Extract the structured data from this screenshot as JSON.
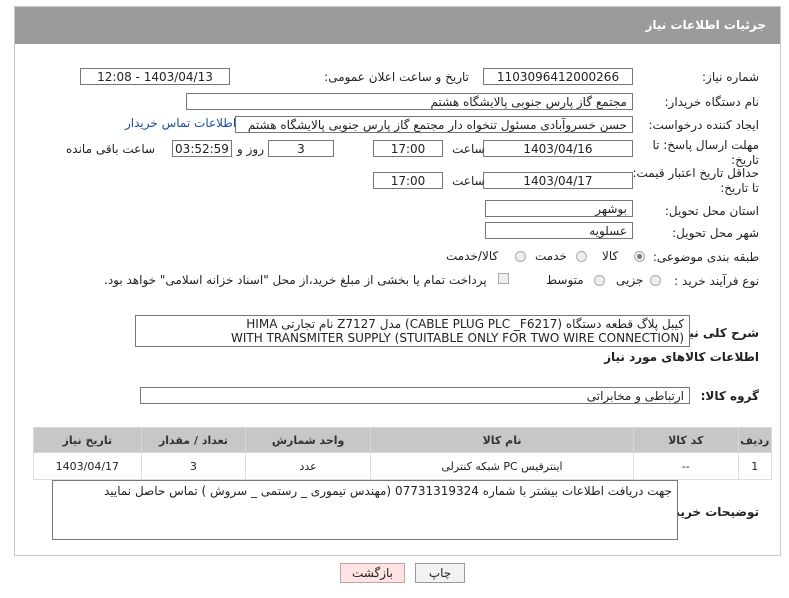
{
  "header": {
    "title": "جزئیات اطلاعات نیاز"
  },
  "form": {
    "need_number_label": "شماره نیاز:",
    "need_number": "1103096412000266",
    "announce_label": "تاریخ و ساعت اعلان عمومی:",
    "announce_value": "1403/04/13 - 12:08",
    "buyer_label": "نام دستگاه خریدار:",
    "buyer_value": "مجتمع گاز پارس جنوبی  پالایشگاه هشتم",
    "creator_label": "ایجاد کننده درخواست:",
    "creator_value": "حسن خسروآبادی مسئول تنخواه دار مجتمع گاز پارس جنوبی  پالایشگاه هشتم",
    "contact_link": "اطلاعات تماس خریدار",
    "deadline_label": "مهلت ارسال پاسخ: تا تاریخ:",
    "deadline_date": "1403/04/16",
    "time_label": "ساعت",
    "deadline_time": "17:00",
    "days_value": "3",
    "days_label": "روز و",
    "remaining_time": "03:52:59",
    "remaining_label": "ساعت باقی مانده",
    "price_valid_label": "حداقل تاریخ اعتبار قیمت: تا تاریخ:",
    "price_valid_date": "1403/04/17",
    "price_valid_time": "17:00",
    "province_label": "استان محل تحویل:",
    "province_value": "بوشهر",
    "city_label": "شهر محل تحویل:",
    "city_value": "عسلویه",
    "category_label": "طبقه بندی موضوعی:",
    "category_options": [
      "کالا",
      "خدمت",
      "کالا/خدمت"
    ],
    "process_label": "نوع فرآیند خرید :",
    "process_options": [
      "جزیی",
      "متوسط"
    ],
    "process_note": "پرداخت تمام یا بخشی از مبلغ خرید،از محل \"اسناد خزانه اسلامی\" خواهد بود.",
    "summary_label": "شرح کلی نیاز:",
    "summary_line1": "کیبل پلاگ قطعه دستگاه (CABLE PLUG  PLC _F6217)  مدل Z7127 نام تجارتی HIMA",
    "summary_line2": "(WITH TRANSMITER SUPPLY  (STUITABLE ONLY FOR TWO WIRE CONNECTION",
    "goods_info_title": "اطلاعات کالاهای مورد نیاز",
    "goods_group_label": "گروه کالا:",
    "goods_group_value": "ارتباطی و مخابراتی",
    "buyer_notes_label": "توضیحات خریدار:",
    "buyer_notes_value": "جهت دریافت اطلاعات بیشتر با شماره 07731319324 (مهندس تیموری _ رستمی _ سروش ) تماس حاصل نمایید"
  },
  "table": {
    "headers": [
      "ردیف",
      "کد کالا",
      "نام کالا",
      "واحد شمارش",
      "تعداد / مقدار",
      "تاریخ نیاز"
    ],
    "rows": [
      [
        "1",
        "--",
        "اینترفیس PC شبکه کنترلی",
        "عدد",
        "3",
        "1403/04/17"
      ]
    ]
  },
  "buttons": {
    "print": "چاپ",
    "back": "بازگشت"
  },
  "colors": {
    "header_bg": "#9b9b9b",
    "link": "#1b4f9c",
    "table_header": "#c7c7c7"
  }
}
